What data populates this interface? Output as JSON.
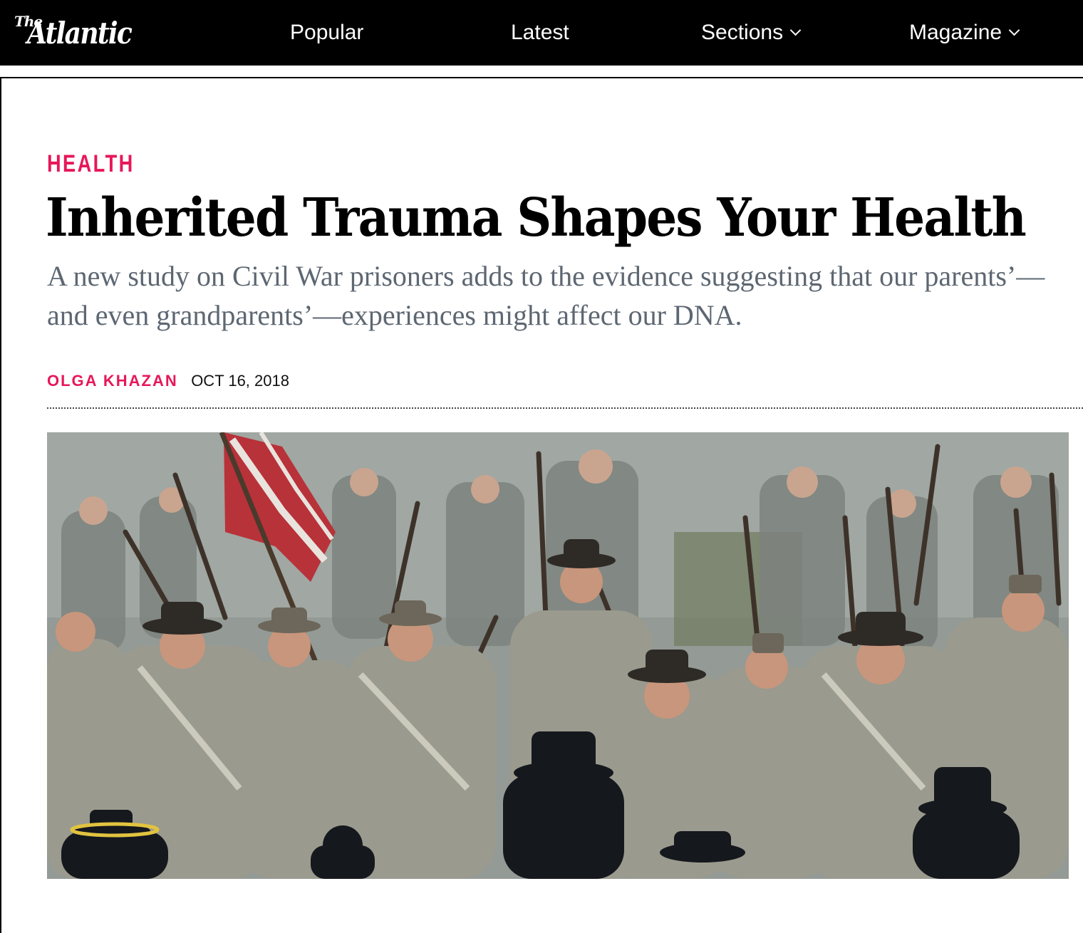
{
  "nav": {
    "logo_the": "The",
    "logo_name": "Atlantic",
    "items": [
      {
        "label": "Popular",
        "has_dropdown": false
      },
      {
        "label": "Latest",
        "has_dropdown": false
      },
      {
        "label": "Sections",
        "has_dropdown": true
      },
      {
        "label": "Magazine",
        "has_dropdown": true
      }
    ]
  },
  "article": {
    "category": "HEALTH",
    "headline": "Inherited Trauma Shapes Your Health",
    "dek": "A new study on Civil War prisoners adds to the evidence suggesting that our parents’—and even grandparents’—experiences might affect our DNA.",
    "author": "OLGA KHAZAN",
    "date": "OCT 16, 2018"
  },
  "colors": {
    "nav_background": "#000000",
    "accent": "#e7175a",
    "dek_text": "#5d6772",
    "headline_text": "#000000"
  }
}
